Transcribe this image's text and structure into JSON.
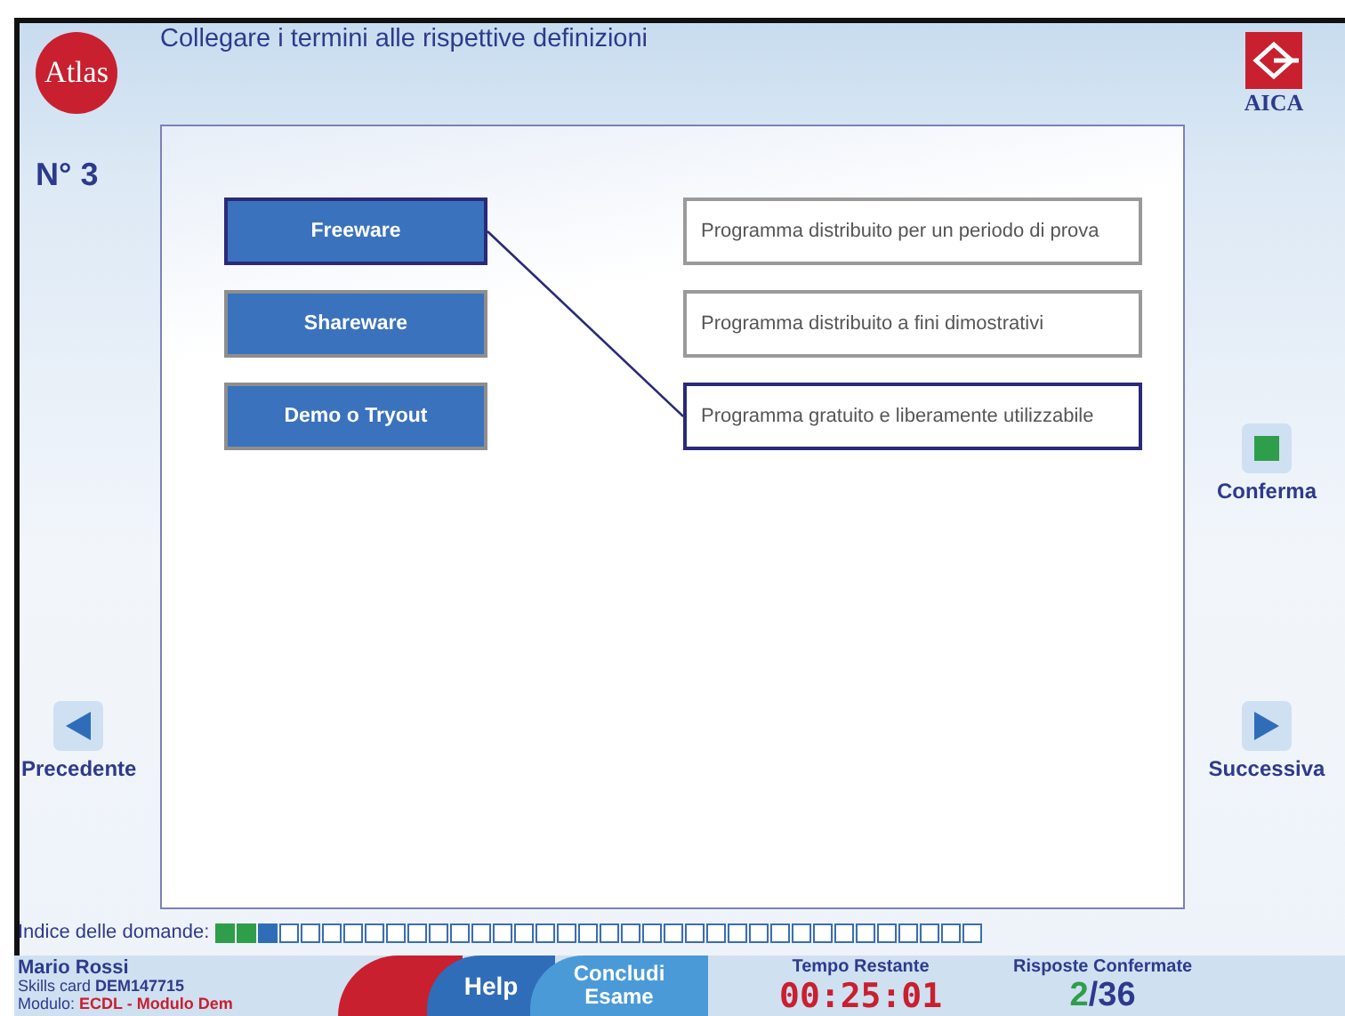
{
  "header": {
    "logo": "Atlas",
    "title": "Collegare i termini alle rispettive definizioni",
    "brand": "AICA"
  },
  "question_number": "N° 3",
  "terms": [
    {
      "label": "Freeware",
      "selected": true,
      "linked": true
    },
    {
      "label": "Shareware",
      "selected": false,
      "linked": false
    },
    {
      "label": "Demo o Tryout",
      "selected": false,
      "linked": false
    }
  ],
  "definitions": [
    {
      "text": "Programma distribuito per un periodo di prova",
      "selected": false,
      "linked": false
    },
    {
      "text": "Programma distribuito a fini dimostrativi",
      "selected": false,
      "linked": false
    },
    {
      "text": "Programma gratuito e liberamente utilizzabile",
      "selected": true,
      "linked": true
    }
  ],
  "nav": {
    "previous": "Precedente",
    "confirm": "Conferma",
    "next": "Successiva"
  },
  "question_index": {
    "label": "Indice delle domande:",
    "items": [
      {
        "answered": true,
        "current": false
      },
      {
        "answered": true,
        "current": false
      },
      {
        "answered": false,
        "current": true
      },
      {
        "answered": false,
        "current": false
      },
      {
        "answered": false,
        "current": false
      },
      {
        "answered": false,
        "current": false
      },
      {
        "answered": false,
        "current": false
      },
      {
        "answered": false,
        "current": false
      },
      {
        "answered": false,
        "current": false
      },
      {
        "answered": false,
        "current": false
      },
      {
        "answered": false,
        "current": false
      },
      {
        "answered": false,
        "current": false
      },
      {
        "answered": false,
        "current": false
      },
      {
        "answered": false,
        "current": false
      },
      {
        "answered": false,
        "current": false
      },
      {
        "answered": false,
        "current": false
      },
      {
        "answered": false,
        "current": false
      },
      {
        "answered": false,
        "current": false
      },
      {
        "answered": false,
        "current": false
      },
      {
        "answered": false,
        "current": false
      },
      {
        "answered": false,
        "current": false
      },
      {
        "answered": false,
        "current": false
      },
      {
        "answered": false,
        "current": false
      },
      {
        "answered": false,
        "current": false
      },
      {
        "answered": false,
        "current": false
      },
      {
        "answered": false,
        "current": false
      },
      {
        "answered": false,
        "current": false
      },
      {
        "answered": false,
        "current": false
      },
      {
        "answered": false,
        "current": false
      },
      {
        "answered": false,
        "current": false
      },
      {
        "answered": false,
        "current": false
      },
      {
        "answered": false,
        "current": false
      },
      {
        "answered": false,
        "current": false
      },
      {
        "answered": false,
        "current": false
      },
      {
        "answered": false,
        "current": false
      },
      {
        "answered": false,
        "current": false
      }
    ]
  },
  "footer": {
    "user_name": "Mario Rossi",
    "skills_card_label": "Skills card",
    "skills_card": "DEM147715",
    "module_label": "Modulo:",
    "module": "ECDL - Modulo Dem",
    "help": "Help",
    "finish": "Concludi Esame",
    "time_label": "Tempo Restante",
    "time": "00:25:01",
    "confirmed_label": "Risposte Confermate",
    "confirmed": "2",
    "total": "/36"
  }
}
